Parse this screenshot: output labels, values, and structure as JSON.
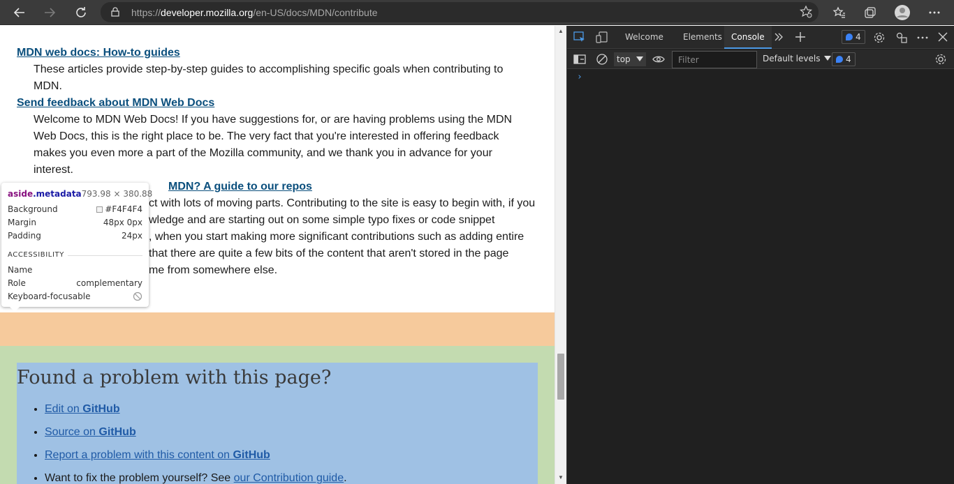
{
  "browser": {
    "url_prefix": "https://",
    "url_domain": "developer.mozilla.org",
    "url_path": "/en-US/docs/MDN/contribute"
  },
  "page": {
    "entries": [
      {
        "title": "MDN web docs: How-to guides",
        "desc": "These articles provide step-by-step guides to accomplishing specific goals when contributing to MDN."
      },
      {
        "title": "Send feedback about MDN Web Docs",
        "desc": "Welcome to MDN Web Docs! If you have suggestions for, or are having problems using the MDN Web Docs, this is the right place to be. The very fact that you're interested in offering feedback makes you even more a part of the Mozilla community, and we thank you in advance for your interest."
      },
      {
        "title": "Where's everything on MDN? A guide to our repos",
        "desc": "MDN is a complex project with lots of moving parts. Contributing to the site is easy to begin with, if you have some basic knowledge and are starting out on some simple typo fixes or code snippet additions. However, when you start making more significant contributions such as adding entire pages, you'll find that there are quite a few bits of the content that aren't stored in the page itself and which come from somewhere else."
      }
    ],
    "visible_third": {
      "title": "MDN? A guide to our repos",
      "lines": [
        "ct with lots of moving parts. Contributing to the site is easy to begin with, if you",
        "wledge and are starting out on some simple typo fixes or code snippet",
        ", when you start making more significant contributions such as adding entire",
        "that there are quite a few bits of the content that aren't stored in the page",
        "me from somewhere else."
      ]
    },
    "feedback": {
      "heading": "Found a problem with this page?",
      "item1_pre": "Edit on ",
      "item1_link": "GitHub",
      "item2_pre": "Source on ",
      "item2_link": "GitHub",
      "item3_pre": "Report a problem with this content on ",
      "item3_link": "GitHub",
      "item4_text": "Want to fix the problem yourself? See ",
      "item4_link": "our Contribution guide",
      "item4_end": "."
    }
  },
  "tooltip": {
    "tag": "aside",
    "cls": ".metadata",
    "dims": "793.98 × 380.88",
    "background_label": "Background",
    "background_value": "#F4F4F4",
    "margin_label": "Margin",
    "margin_value": "48px 0px",
    "padding_label": "Padding",
    "padding_value": "24px",
    "section": "ACCESSIBILITY",
    "name_label": "Name",
    "role_label": "Role",
    "role_value": "complementary",
    "focus_label": "Keyboard-focusable"
  },
  "devtools": {
    "tabs": [
      "Welcome",
      "Elements",
      "Console"
    ],
    "active_tab": "Console",
    "issues_count": "4",
    "context": "top",
    "filter_placeholder": "Filter",
    "levels": "Default levels",
    "messages_count": "4",
    "prompt": "›"
  },
  "colors": {
    "margin_overlay": "#f6ca9c",
    "padding_overlay": "#c3dbb0",
    "content_overlay": "#9fc1e4",
    "link": "#0b4f7d",
    "devtools_bg": "#202020"
  }
}
